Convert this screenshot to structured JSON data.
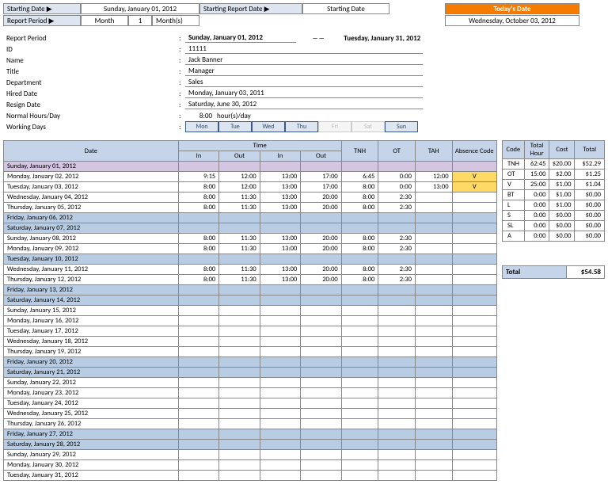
{
  "top": {
    "starting_date_lbl": "Starting Date ▶",
    "starting_date_val": "Sunday, January 01, 2012",
    "starting_report_lbl": "Starting Report Date ▶",
    "starting_report_val": "Starting Date",
    "todays_date_lbl": "Today's Date",
    "report_period_lbl": "Report Period ▶",
    "report_period_unit": "Month",
    "report_period_n": "1",
    "report_period_suffix": "Month(s)",
    "todays_date_val": "Wednesday, October 03, 2012"
  },
  "info": {
    "report_period_lbl": "Report Period",
    "report_period_from": "Sunday, January 01, 2012",
    "report_period_to": "Tuesday, January 31, 2012",
    "id_lbl": "ID",
    "id_val": "11111",
    "name_lbl": "Name",
    "name_val": "Jack Banner",
    "title_lbl": "Title",
    "title_val": "Manager",
    "dept_lbl": "Department",
    "dept_val": "Sales",
    "hired_lbl": "Hired Date",
    "hired_val": "Monday, January 03, 2011",
    "resign_lbl": "Resign Date",
    "resign_val": "Saturday, June 30, 2012",
    "hours_lbl": "Normal Hours/Day",
    "hours_val": "8:00",
    "hours_suffix": "hour(s)/day",
    "days_lbl": "Working Days"
  },
  "days": [
    {
      "l": "Mon",
      "on": true
    },
    {
      "l": "Tue",
      "on": true
    },
    {
      "l": "Wed",
      "on": true
    },
    {
      "l": "Thu",
      "on": true
    },
    {
      "l": "Fri",
      "on": false
    },
    {
      "l": "Sat",
      "on": false
    },
    {
      "l": "Sun",
      "on": true
    }
  ],
  "att_hdr": {
    "date": "Date",
    "time": "Time",
    "in": "In",
    "out": "Out",
    "tnh": "TNH",
    "ot": "OT",
    "tah": "TAH",
    "abs": "Absence Code"
  },
  "att_rows": [
    {
      "d": "Sunday, January 01, 2012",
      "cls": "row-purple"
    },
    {
      "d": "Monday, January 02, 2012",
      "t": [
        "9:15",
        "12:00",
        "13:00",
        "17:00"
      ],
      "tnh": "6:45",
      "ot": "0:00",
      "tah": "12:00",
      "abs": "V",
      "abscls": "row-yellow"
    },
    {
      "d": "Tuesday, January 03, 2012",
      "t": [
        "8:00",
        "12:00",
        "13:00",
        "17:00"
      ],
      "tnh": "8:00",
      "ot": "0:00",
      "tah": "13:00",
      "abs": "V",
      "abscls": "row-yellow"
    },
    {
      "d": "Wednesday, January 04, 2012",
      "t": [
        "8:00",
        "11:30",
        "13:00",
        "20:00"
      ],
      "tnh": "8:00",
      "ot": "2:30"
    },
    {
      "d": "Thursday, January 05, 2012",
      "t": [
        "8:00",
        "11:30",
        "13:00",
        "20:00"
      ],
      "tnh": "8:00",
      "ot": "2:30"
    },
    {
      "d": "Friday, January 06, 2012",
      "cls": "row-blue"
    },
    {
      "d": "Saturday, January 07, 2012",
      "cls": "row-blue"
    },
    {
      "d": "Sunday, January 08, 2012",
      "t": [
        "8:00",
        "11:30",
        "13:00",
        "20:00"
      ],
      "tnh": "8:00",
      "ot": "2:30"
    },
    {
      "d": "Monday, January 09, 2012",
      "t": [
        "8:00",
        "11:30",
        "13:00",
        "20:00"
      ],
      "tnh": "8:00",
      "ot": "2:30"
    },
    {
      "d": "Tuesday, January 10, 2012",
      "cls": "row-blue"
    },
    {
      "d": "Wednesday, January 11, 2012",
      "t": [
        "8:00",
        "11:30",
        "13:00",
        "20:00"
      ],
      "tnh": "8:00",
      "ot": "2:30"
    },
    {
      "d": "Thursday, January 12, 2012",
      "t": [
        "8:00",
        "11:30",
        "13:00",
        "20:00"
      ],
      "tnh": "8:00",
      "ot": "2:30"
    },
    {
      "d": "Friday, January 13, 2012",
      "cls": "row-blue"
    },
    {
      "d": "Saturday, January 14, 2012",
      "cls": "row-blue"
    },
    {
      "d": "Sunday, January 15, 2012"
    },
    {
      "d": "Monday, January 16, 2012"
    },
    {
      "d": "Tuesday, January 17, 2012"
    },
    {
      "d": "Wednesday, January 18, 2012"
    },
    {
      "d": "Thursday, January 19, 2012"
    },
    {
      "d": "Friday, January 20, 2012",
      "cls": "row-blue"
    },
    {
      "d": "Saturday, January 21, 2012",
      "cls": "row-blue"
    },
    {
      "d": "Sunday, January 22, 2012"
    },
    {
      "d": "Monday, January 23, 2012"
    },
    {
      "d": "Tuesday, January 24, 2012"
    },
    {
      "d": "Wednesday, January 25, 2012"
    },
    {
      "d": "Thursday, January 26, 2012"
    },
    {
      "d": "Friday, January 27, 2012",
      "cls": "row-blue"
    },
    {
      "d": "Saturday, January 28, 2012",
      "cls": "row-blue"
    },
    {
      "d": "Sunday, January 29, 2012"
    },
    {
      "d": "Monday, January 30, 2012"
    },
    {
      "d": "Tuesday, January 31, 2012"
    }
  ],
  "summary_hdr": {
    "code": "Code",
    "hour": "Total Hour",
    "cost": "Cost",
    "total": "Total"
  },
  "summary_rows": [
    {
      "c": "TNH",
      "h": "62:45",
      "cost": "$20.00",
      "t": "$52.29"
    },
    {
      "c": "OT",
      "h": "15:00",
      "cost": "$2.00",
      "t": "$1.25"
    },
    {
      "c": "V",
      "h": "25:00",
      "cost": "$1.00",
      "t": "$1.04"
    },
    {
      "c": "BT",
      "h": "0:00",
      "cost": "$1.00",
      "t": "$0.00"
    },
    {
      "c": "L",
      "h": "0:00",
      "cost": "$1.00",
      "t": "$0.00"
    },
    {
      "c": "S",
      "h": "0:00",
      "cost": "$0.00",
      "t": "$0.00"
    },
    {
      "c": "SL",
      "h": "0:00",
      "cost": "$0.00",
      "t": "$0.00"
    },
    {
      "c": "A",
      "h": "0:00",
      "cost": "$0.00",
      "t": "$0.00"
    }
  ],
  "grand_total": {
    "lbl": "Total",
    "val": "$54.58"
  }
}
